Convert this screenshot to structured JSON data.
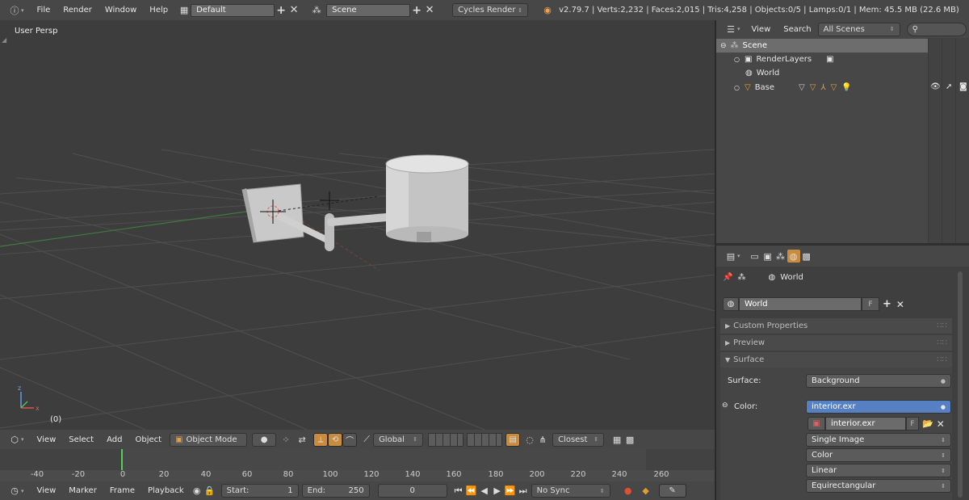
{
  "info_header": {
    "menus": [
      "File",
      "Render",
      "Window",
      "Help"
    ],
    "screen_layout": "Default",
    "scene": "Scene",
    "engine": "Cycles Render",
    "stats": "v2.79.7 | Verts:2,232 | Faces:2,015 | Tris:4,258 | Objects:0/5 | Lamps:0/1 | Mem: 45.5 MB (22.6 MB)"
  },
  "viewport": {
    "label": "User Persp",
    "frame_label": "(0)",
    "header": {
      "menus": [
        "View",
        "Select",
        "Add",
        "Object"
      ],
      "mode": "Object Mode",
      "orientation": "Global",
      "snap_target": "Closest"
    }
  },
  "outliner": {
    "menus": [
      "View",
      "Search"
    ],
    "display_mode": "All Scenes",
    "items": [
      {
        "label": "Scene",
        "selected": true
      },
      {
        "label": "RenderLayers",
        "selected": false
      },
      {
        "label": "World",
        "selected": false
      },
      {
        "label": "Base",
        "selected": false
      }
    ]
  },
  "properties": {
    "context_label": "World",
    "world_name": "World",
    "fake_user": "F",
    "panels": {
      "custom_properties": "Custom Properties",
      "preview": "Preview",
      "surface": "Surface"
    },
    "surface_label": "Surface:",
    "surface_value": "Background",
    "color_label": "Color:",
    "color_value": "interior.exr",
    "image_name": "interior.exr",
    "image_fake": "F",
    "options": [
      "Single Image",
      "Color",
      "Linear",
      "Equirectangular"
    ]
  },
  "timeline": {
    "ticks": [
      "-40",
      "-20",
      "0",
      "20",
      "40",
      "60",
      "80",
      "100",
      "120",
      "140",
      "160",
      "180",
      "200",
      "220",
      "240",
      "260"
    ],
    "menus": [
      "View",
      "Marker",
      "Frame",
      "Playback"
    ],
    "start_label": "Start:",
    "start_value": "1",
    "end_label": "End:",
    "end_value": "250",
    "current_frame": "0",
    "sync": "No Sync"
  },
  "colors": {
    "accent": "#5680c2",
    "selected_row": "#6d6d6d",
    "timeline_cursor": "#55d055"
  }
}
